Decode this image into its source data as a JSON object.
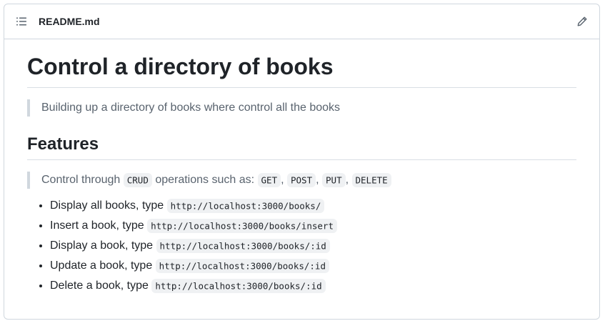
{
  "header": {
    "filename": "README.md",
    "toc_icon": "list-unordered-icon",
    "edit_icon": "pencil-icon"
  },
  "content": {
    "title": "Control a directory of books",
    "intro_quote": "Building up a directory of books where control all the books",
    "features_heading": "Features",
    "features_quote": {
      "prefix": "Control through",
      "crud": "CRUD",
      "middle": "operations such as:",
      "methods": [
        "GET",
        "POST",
        "PUT",
        "DELETE"
      ],
      "sep": ","
    },
    "features": [
      {
        "text": "Display all books, type",
        "code": "http://localhost:3000/books/"
      },
      {
        "text": "Insert a book, type",
        "code": "http://localhost:3000/books/insert"
      },
      {
        "text": "Display a book, type",
        "code": "http://localhost:3000/books/:id"
      },
      {
        "text": "Update a book, type",
        "code": "http://localhost:3000/books/:id"
      },
      {
        "text": "Delete a book, type",
        "code": "http://localhost:3000/books/:id"
      }
    ]
  },
  "colors": {
    "border": "#d0d7de",
    "text": "#1f2328",
    "muted": "#59636e",
    "code_bg": "#eff1f3"
  }
}
